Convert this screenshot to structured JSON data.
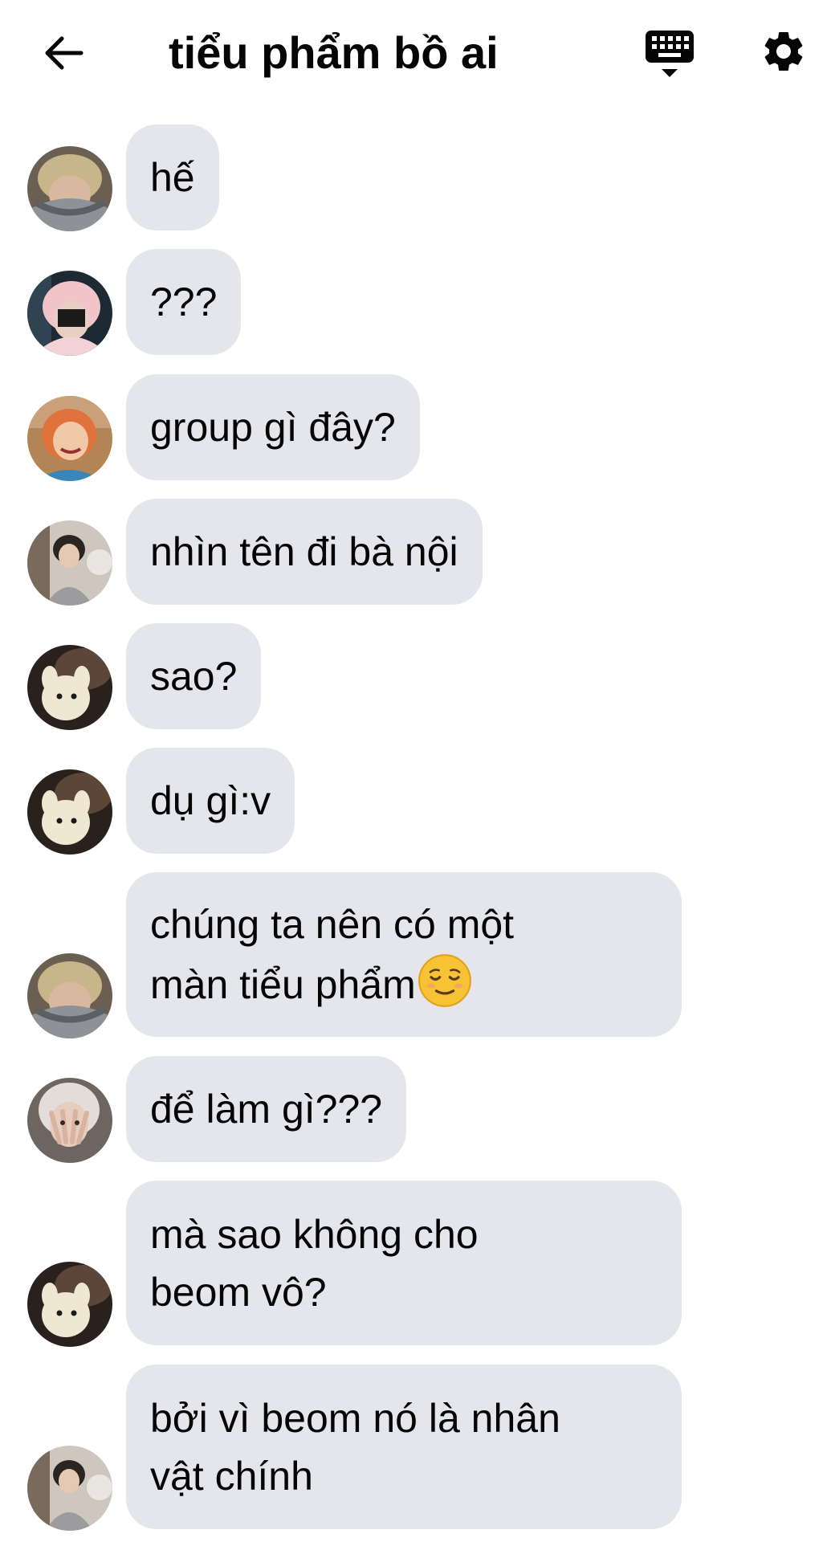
{
  "header": {
    "title": "tiểu phẩm bồ ai",
    "back_icon": "back-arrow-icon",
    "keyboard_icon": "keyboard-icon",
    "settings_icon": "gear-icon"
  },
  "colors": {
    "bubble": "#e4e6eb",
    "text": "#050505",
    "background": "#ffffff"
  },
  "messages": [
    {
      "text": "hế",
      "avatar": "avatar-1"
    },
    {
      "text": "???",
      "avatar": "avatar-2"
    },
    {
      "text": "group gì đây?",
      "avatar": "avatar-3"
    },
    {
      "text": "nhìn tên đi bà nội",
      "avatar": "avatar-4"
    },
    {
      "text": "sao?",
      "avatar": "avatar-5"
    },
    {
      "text": "dụ gì:v",
      "avatar": "avatar-5"
    },
    {
      "text": "chúng ta nên có một\nmàn tiểu phẩm",
      "emoji": "relieved-face-emoji",
      "avatar": "avatar-1"
    },
    {
      "text": "để làm gì???",
      "avatar": "avatar-6"
    },
    {
      "text": "mà sao không cho\nbeom vô?",
      "avatar": "avatar-5"
    },
    {
      "text": "bởi vì beom nó là nhân\nvật chính",
      "avatar": "avatar-4"
    }
  ]
}
